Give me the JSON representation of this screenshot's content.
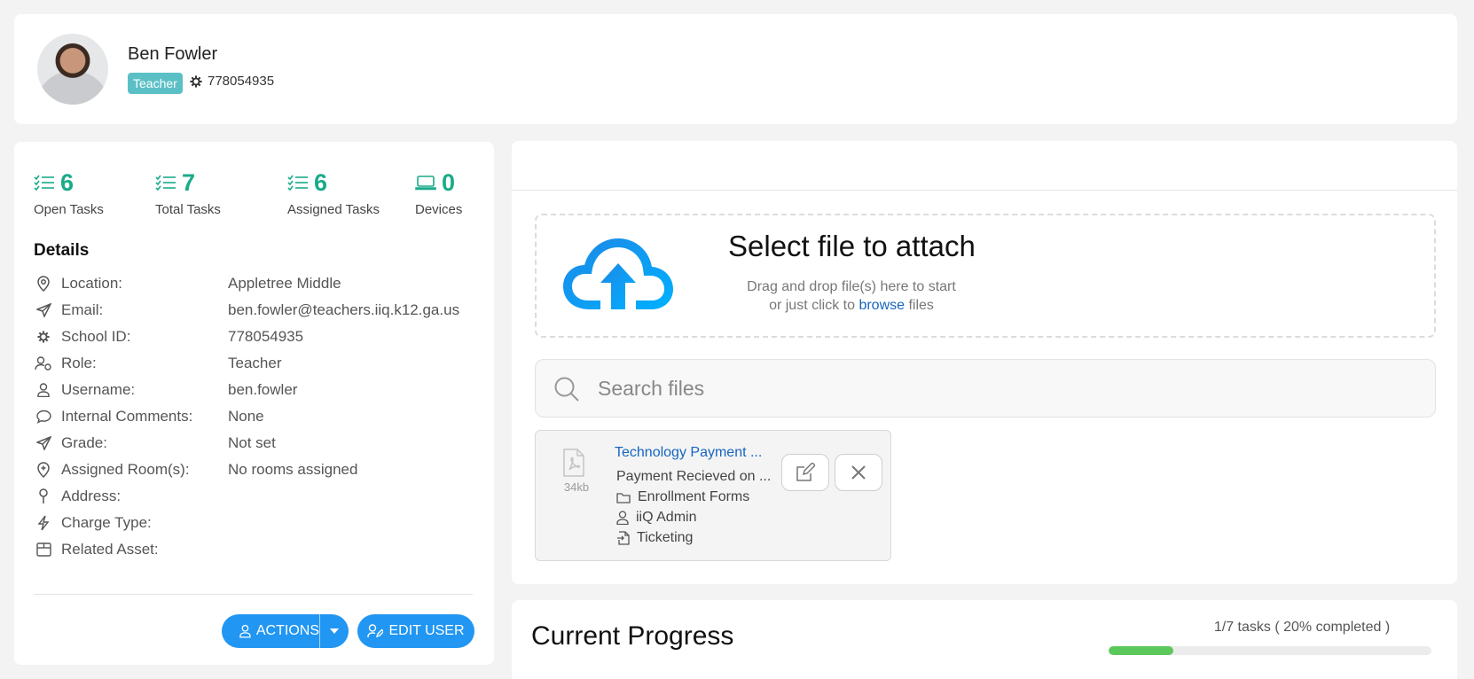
{
  "profile": {
    "name": "Ben Fowler",
    "role_badge": "Teacher",
    "school_id": "778054935"
  },
  "stats": [
    {
      "value": "6",
      "label": "Open Tasks",
      "icon": "checklist-icon"
    },
    {
      "value": "7",
      "label": "Total Tasks",
      "icon": "checklist-icon"
    },
    {
      "value": "6",
      "label": "Assigned Tasks",
      "icon": "checklist-icon"
    },
    {
      "value": "0",
      "label": "Devices",
      "icon": "laptop-icon"
    }
  ],
  "details": {
    "title": "Details",
    "rows": [
      {
        "label": "Location:",
        "value": "Appletree Middle",
        "icon": "location-pin-icon"
      },
      {
        "label": "Email:",
        "value": "ben.fowler@teachers.iiq.k12.ga.us",
        "icon": "paper-plane-icon"
      },
      {
        "label": "School ID:",
        "value": "778054935",
        "icon": "gear-badge-icon"
      },
      {
        "label": "Role:",
        "value": "Teacher",
        "icon": "user-role-icon"
      },
      {
        "label": "Username:",
        "value": "ben.fowler",
        "icon": "user-icon"
      },
      {
        "label": "Internal Comments:",
        "value": "None",
        "icon": "comment-icon"
      },
      {
        "label": "Grade:",
        "value": "Not set",
        "icon": "paper-plane-icon"
      },
      {
        "label": "Assigned Room(s):",
        "value": "No rooms assigned",
        "icon": "room-pin-icon"
      },
      {
        "label": "Address:",
        "value": "",
        "icon": "map-pin-icon"
      },
      {
        "label": "Charge Type:",
        "value": "",
        "icon": "lightning-icon"
      },
      {
        "label": "Related Asset:",
        "value": "",
        "icon": "box-icon"
      }
    ]
  },
  "buttons": {
    "actions": "ACTIONS",
    "edit_user": "EDIT USER"
  },
  "attachments": {
    "drop_title": "Select file to attach",
    "drop_line1": "Drag and drop file(s) here to start",
    "drop_line2_pre": "or just click to",
    "drop_link": "browse",
    "drop_line2_post": "files",
    "search_placeholder": "Search files",
    "file": {
      "title": "Technology Payment ...",
      "size": "34kb",
      "description": "Payment Recieved on ...",
      "folder": "Enrollment Forms",
      "owner": "iiQ Admin",
      "module": "Ticketing"
    }
  },
  "progress": {
    "title": "Current Progress",
    "summary": "1/7 tasks ( 20% completed )",
    "percent": 20,
    "fill_color": "#5cc85c"
  },
  "colors": {
    "accent": "#2196f3",
    "stat_green": "#1aab8a",
    "badge_teal": "#5bc0c5",
    "link_blue": "#1565c0"
  }
}
